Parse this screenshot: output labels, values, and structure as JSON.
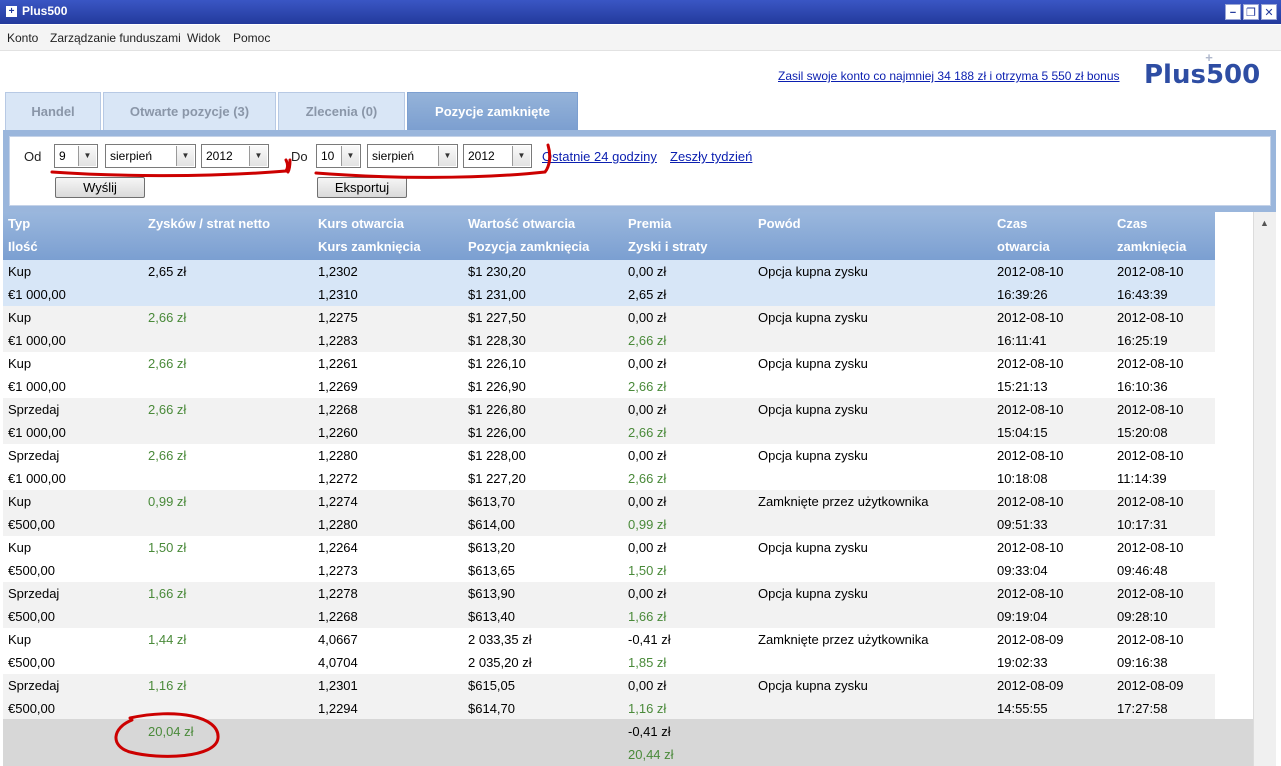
{
  "window": {
    "title": "Plus500",
    "minimize": "−",
    "restore": "❐",
    "close": "✕",
    "app_icon": "+"
  },
  "menu": [
    "Konto",
    "Zarządzanie funduszami",
    "Widok",
    "Pomoc"
  ],
  "promo": "Zasil swoje konto co najmniej 34 188 zł i otrzyma 5 550 zł bonus",
  "logo": {
    "text": "Plus500",
    "plus": "+"
  },
  "tabs": [
    "Handel",
    "Otwarte pozycje (3)",
    "Zlecenia (0)",
    "Pozycje zamknięte"
  ],
  "filter": {
    "from_label": "Od",
    "to_label": "Do",
    "from_day": "9",
    "from_month": "sierpień",
    "from_year": "2012",
    "to_day": "10",
    "to_month": "sierpień",
    "to_year": "2012",
    "link_24h": "Ostatnie 24 godziny",
    "link_week": "Zeszły tydzień",
    "send": "Wyślij",
    "export": "Eksportuj"
  },
  "headers": {
    "type": "Typ",
    "amount": "Ilość",
    "net": "Zysków / strat netto",
    "open_rate": "Kurs otwarcia",
    "close_rate": "Kurs zamknięcia",
    "open_value": "Wartość otwarcia",
    "close_pos": "Pozycja zamknięcia",
    "premium": "Premia",
    "pnl": "Zyski i straty",
    "reason": "Powód",
    "time_open_1": "Czas",
    "time_open_2": "otwarcia",
    "time_close_1": "Czas",
    "time_close_2": "zamknięcia"
  },
  "rows": [
    {
      "type": "Kup",
      "amount": "€1 000,00",
      "net": "2,65 zł",
      "open_rate": "1,2302",
      "close_rate": "1,2310",
      "open_value": "$1 230,20",
      "close_pos": "$1 231,00",
      "premium": "0,00 zł",
      "pnl": "2,65 zł",
      "reason": "Opcja kupna zysku",
      "open_date": "2012-08-10",
      "open_time": "16:39:26",
      "close_date": "2012-08-10",
      "close_time": "16:43:39"
    },
    {
      "type": "Kup",
      "amount": "€1 000,00",
      "net": "2,66 zł",
      "open_rate": "1,2275",
      "close_rate": "1,2283",
      "open_value": "$1 227,50",
      "close_pos": "$1 228,30",
      "premium": "0,00 zł",
      "pnl": "2,66 zł",
      "reason": "Opcja kupna zysku",
      "open_date": "2012-08-10",
      "open_time": "16:11:41",
      "close_date": "2012-08-10",
      "close_time": "16:25:19"
    },
    {
      "type": "Kup",
      "amount": "€1 000,00",
      "net": "2,66 zł",
      "open_rate": "1,2261",
      "close_rate": "1,2269",
      "open_value": "$1 226,10",
      "close_pos": "$1 226,90",
      "premium": "0,00 zł",
      "pnl": "2,66 zł",
      "reason": "Opcja kupna zysku",
      "open_date": "2012-08-10",
      "open_time": "15:21:13",
      "close_date": "2012-08-10",
      "close_time": "16:10:36"
    },
    {
      "type": "Sprzedaj",
      "amount": "€1 000,00",
      "net": "2,66 zł",
      "open_rate": "1,2268",
      "close_rate": "1,2260",
      "open_value": "$1 226,80",
      "close_pos": "$1 226,00",
      "premium": "0,00 zł",
      "pnl": "2,66 zł",
      "reason": "Opcja kupna zysku",
      "open_date": "2012-08-10",
      "open_time": "15:04:15",
      "close_date": "2012-08-10",
      "close_time": "15:20:08"
    },
    {
      "type": "Sprzedaj",
      "amount": "€1 000,00",
      "net": "2,66 zł",
      "open_rate": "1,2280",
      "close_rate": "1,2272",
      "open_value": "$1 228,00",
      "close_pos": "$1 227,20",
      "premium": "0,00 zł",
      "pnl": "2,66 zł",
      "reason": "Opcja kupna zysku",
      "open_date": "2012-08-10",
      "open_time": "10:18:08",
      "close_date": "2012-08-10",
      "close_time": "11:14:39"
    },
    {
      "type": "Kup",
      "amount": "€500,00",
      "net": "0,99 zł",
      "open_rate": "1,2274",
      "close_rate": "1,2280",
      "open_value": "$613,70",
      "close_pos": "$614,00",
      "premium": "0,00 zł",
      "pnl": "0,99 zł",
      "reason": "Zamknięte przez użytkownika",
      "open_date": "2012-08-10",
      "open_time": "09:51:33",
      "close_date": "2012-08-10",
      "close_time": "10:17:31"
    },
    {
      "type": "Kup",
      "amount": "€500,00",
      "net": "1,50 zł",
      "open_rate": "1,2264",
      "close_rate": "1,2273",
      "open_value": "$613,20",
      "close_pos": "$613,65",
      "premium": "0,00 zł",
      "pnl": "1,50 zł",
      "reason": "Opcja kupna zysku",
      "open_date": "2012-08-10",
      "open_time": "09:33:04",
      "close_date": "2012-08-10",
      "close_time": "09:46:48"
    },
    {
      "type": "Sprzedaj",
      "amount": "€500,00",
      "net": "1,66 zł",
      "open_rate": "1,2278",
      "close_rate": "1,2268",
      "open_value": "$613,90",
      "close_pos": "$613,40",
      "premium": "0,00 zł",
      "pnl": "1,66 zł",
      "reason": "Opcja kupna zysku",
      "open_date": "2012-08-10",
      "open_time": "09:19:04",
      "close_date": "2012-08-10",
      "close_time": "09:28:10"
    },
    {
      "type": "Kup",
      "amount": "€500,00",
      "net": "1,44 zł",
      "open_rate": "4,0667",
      "close_rate": "4,0704",
      "open_value": "2 033,35 zł",
      "close_pos": "2 035,20 zł",
      "premium": "-0,41 zł",
      "pnl": "1,85 zł",
      "reason": "Zamknięte przez użytkownika",
      "open_date": "2012-08-09",
      "open_time": "19:02:33",
      "close_date": "2012-08-10",
      "close_time": "09:16:38"
    },
    {
      "type": "Sprzedaj",
      "amount": "€500,00",
      "net": "1,16 zł",
      "open_rate": "1,2301",
      "close_rate": "1,2294",
      "open_value": "$615,05",
      "close_pos": "$614,70",
      "premium": "0,00 zł",
      "pnl": "1,16 zł",
      "reason": "Opcja kupna zysku",
      "open_date": "2012-08-09",
      "open_time": "14:55:55",
      "close_date": "2012-08-09",
      "close_time": "17:27:58"
    }
  ],
  "totals": {
    "net": "20,04 zł",
    "premium": "-0,41 zł",
    "pnl": "20,44 zł"
  },
  "colors": {
    "green": "#4a8a3a",
    "header": "#7b9fd1",
    "annotation": "#cc0000"
  }
}
